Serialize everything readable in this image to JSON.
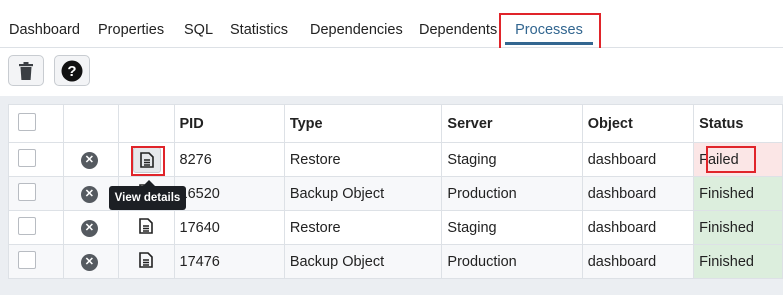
{
  "tabs": [
    {
      "label": "Dashboard"
    },
    {
      "label": "Properties"
    },
    {
      "label": "SQL"
    },
    {
      "label": "Statistics"
    },
    {
      "label": "Dependencies"
    },
    {
      "label": "Dependents"
    },
    {
      "label": "Processes"
    }
  ],
  "active_tab": "Processes",
  "toolbar": {
    "delete_icon": "trash-icon",
    "help_icon": "question-circle-icon"
  },
  "table": {
    "columns": [
      "",
      "",
      "",
      "PID",
      "Type",
      "Server",
      "Object",
      "Status"
    ],
    "rows": [
      {
        "pid": "8276",
        "type": "Restore",
        "server": "Staging",
        "object": "dashboard",
        "status": "Failed"
      },
      {
        "pid": "16520",
        "type": "Backup Object",
        "server": "Production",
        "object": "dashboard",
        "status": "Finished"
      },
      {
        "pid": "17640",
        "type": "Restore",
        "server": "Staging",
        "object": "dashboard",
        "status": "Finished"
      },
      {
        "pid": "17476",
        "type": "Backup Object",
        "server": "Production",
        "object": "dashboard",
        "status": "Finished"
      }
    ]
  },
  "tooltip": {
    "text": "View details"
  },
  "colors": {
    "accent": "#326690",
    "failed_bg": "#fbe6e6",
    "finished_bg": "#dceedd",
    "highlight": "#e0242a"
  }
}
